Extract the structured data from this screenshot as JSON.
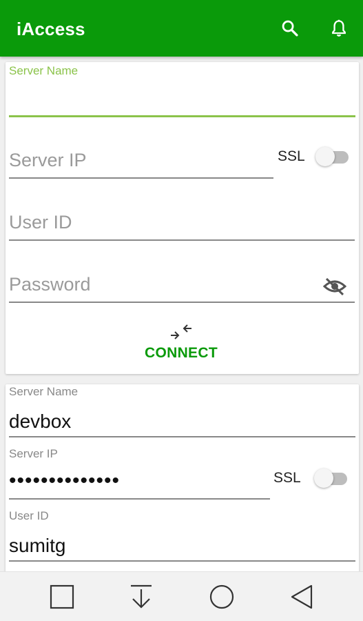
{
  "app": {
    "title": "iAccess",
    "brand_color": "#0a9a0a",
    "icons": [
      "search-icon",
      "bell-icon"
    ]
  },
  "connect_form": {
    "server_name": {
      "label": "Server Name",
      "value": ""
    },
    "server_ip": {
      "placeholder": "Server IP"
    },
    "ssl": {
      "label": "SSL",
      "enabled": false
    },
    "user_id": {
      "placeholder": "User ID"
    },
    "password": {
      "placeholder": "Password",
      "icon": "eye-off-icon"
    },
    "connect_button": {
      "label": "CONNECT",
      "icon": "connect-arrows-icon"
    }
  },
  "saved_server": {
    "server_name": {
      "label": "Server Name",
      "value": "devbox"
    },
    "server_ip": {
      "label": "Server IP",
      "value": "••••••••••••••"
    },
    "ssl": {
      "label": "SSL",
      "enabled": false
    },
    "user_id": {
      "label": "User ID",
      "value": "sumitg"
    }
  },
  "nav_bar": {
    "icons": [
      "recents-square-icon",
      "download-arrow-icon",
      "home-circle-icon",
      "back-triangle-icon"
    ]
  }
}
